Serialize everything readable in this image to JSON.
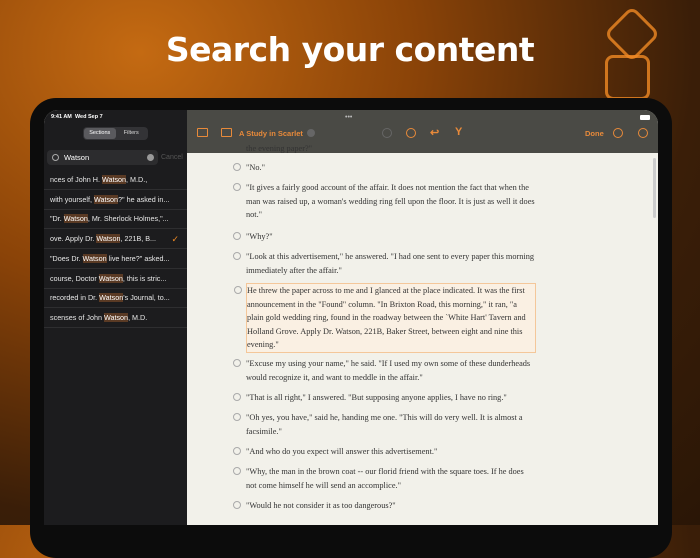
{
  "headline": "Search your content",
  "status": {
    "time": "9:41 AM",
    "date": "Wed Sep 7"
  },
  "sidebar": {
    "segments": [
      "Sections",
      "Filters"
    ],
    "search_value": "Watson",
    "cancel": "Cancel",
    "results": [
      {
        "pre": "nces of John H. ",
        "hit": "Watson",
        "post": ", M.D.,"
      },
      {
        "pre": " with yourself, ",
        "hit": "Watson",
        "post": "?\" he asked in..."
      },
      {
        "pre": "\"Dr. ",
        "hit": "Watson",
        "post": ", Mr. Sherlock Holmes,\"..."
      },
      {
        "pre": "ove.  Apply Dr. ",
        "hit": "Watson",
        "post": ", 221B, B...",
        "selected": true
      },
      {
        "pre": "\"Does Dr. ",
        "hit": "Watson",
        "post": " live here?\" asked..."
      },
      {
        "pre": " course, Doctor ",
        "hit": "Watson",
        "post": ", this is stric..."
      },
      {
        "pre": "recorded in Dr. ",
        "hit": "Watson",
        "post": "'s Journal, to..."
      },
      {
        "pre": "scenses of John ",
        "hit": "Watson",
        "post": ", M.D."
      }
    ]
  },
  "toolbar": {
    "title": "A Study in Scarlet",
    "done": "Done"
  },
  "paragraphs": [
    "the evening paper?\"",
    "\"No.\"",
    "\"It gives a fairly good account of the affair.  It does not mention the fact that when the man was raised up, a woman's wedding ring fell upon the floor.  It is just as well it does not.\"",
    "\"Why?\"",
    "\"Look at this advertisement,\" he answered. \"I had one sent to every paper this morning immediately after the affair.\"",
    "He threw the paper across to me and I glanced at the place indicated.  It was the first announcement in the \"Found\" column. \"In Brixton Road, this morning,\" it ran, \"a plain gold wedding ring, found in the roadway between the `White Hart' Tavern and Holland Grove.  Apply Dr. Watson, 221B, Baker Street, between eight and nine this evening.\"",
    "\"Excuse my using your name,\" he said.  \"If I used my own some of these dunderheads would recognize it, and want to meddle in the affair.\"",
    "\"That is all right,\" I answered.  \"But supposing anyone applies, I have no ring.\"",
    "\"Oh yes, you have,\" said he, handing me one.  \"This will do very well.  It is almost a facsimile.\"",
    "\"And who do you expect will answer this advertisement.\"",
    "\"Why, the man in the brown coat -- our florid friend with the square toes.  If he does not come himself he will send an accomplice.\"",
    "\"Would he not consider it as too dangerous?\""
  ]
}
